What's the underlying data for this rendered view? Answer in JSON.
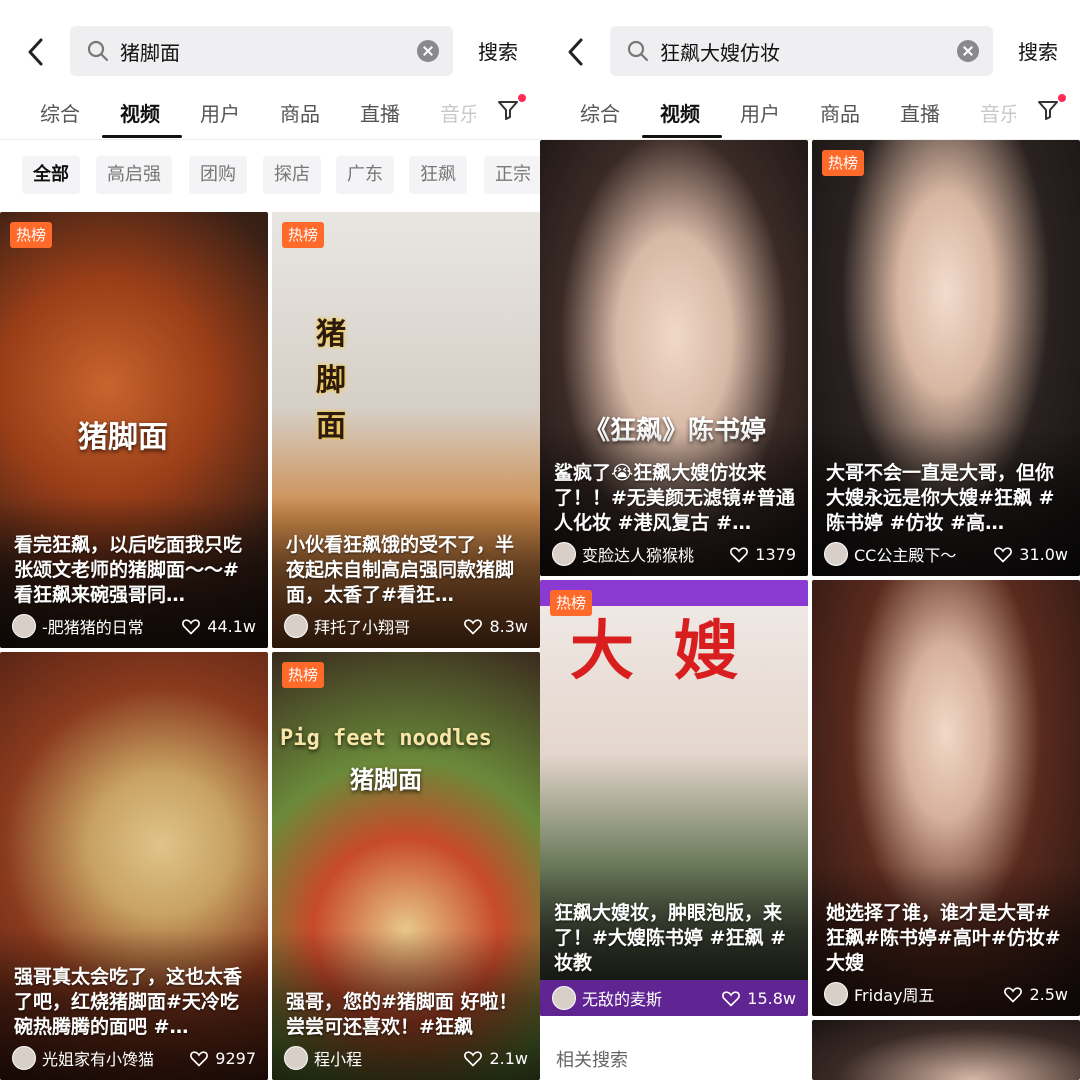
{
  "left": {
    "query": "猪脚面",
    "search_label": "搜索",
    "tabs": [
      "综合",
      "视频",
      "用户",
      "商品",
      "直播",
      "音乐"
    ],
    "active_tab": "视频",
    "chips": [
      "全部",
      "高启强",
      "团购",
      "探店",
      "广东",
      "狂飙",
      "正宗"
    ],
    "cards": [
      {
        "badge": "热榜",
        "overlay": "猪脚面",
        "caption": "看完狂飙，以后吃面我只吃张颂文老师的猪脚面～～#看狂飙来碗强哥同…",
        "author": "-肥猪猪的日常",
        "likes": "44.1w"
      },
      {
        "badge": "热榜",
        "overlay": "猪脚面",
        "caption": "小伙看狂飙饿的受不了，半夜起床自制高启强同款猪脚面，太香了#看狂…",
        "author": "拜托了小翔哥",
        "likes": "8.3w"
      },
      {
        "badge": "",
        "overlay": "",
        "caption": "强哥真太会吃了，这也太香了吧，红烧猪脚面#天冷吃碗热腾腾的面吧 #…",
        "author": "光姐家有小馋猫",
        "likes": "9297"
      },
      {
        "badge": "热榜",
        "overlay": "Pig feet noodles",
        "overlay2": "猪脚面",
        "caption": "强哥，您的#猪脚面 好啦！尝尝可还喜欢！#狂飙",
        "author": "程小程",
        "likes": "2.1w"
      }
    ]
  },
  "right": {
    "query": "狂飙大嫂仿妆",
    "search_label": "搜索",
    "tabs": [
      "综合",
      "视频",
      "用户",
      "商品",
      "直播",
      "音乐"
    ],
    "active_tab": "视频",
    "cards": [
      {
        "badge": "",
        "overlay": "《狂飙》陈书婷",
        "caption": "鲨疯了😭狂飙大嫂仿妆来了！！#无美颜无滤镜#普通人化妆 #港风复古 #…",
        "author": "变脸达人猕猴桃",
        "likes": "1379"
      },
      {
        "badge": "热榜",
        "overlay": "",
        "caption": "大哥不会一直是大哥，但你大嫂永远是你大嫂#狂飙 #陈书婷 #仿妆 #高…",
        "author": "CC公主殿下～",
        "likes": "31.0w"
      },
      {
        "badge": "热榜",
        "overlay": "大嫂",
        "caption": "狂飙大嫂妆，肿眼泡版，来了！#大嫂陈书婷 #狂飙 #妆教",
        "author": "无敌的麦斯",
        "likes": "15.8w"
      },
      {
        "badge": "",
        "overlay": "",
        "caption": "她选择了谁，谁才是大哥#狂飙#陈书婷#高叶#仿妆#大嫂",
        "author": "Friday周五",
        "likes": "2.5w"
      }
    ],
    "related_label": "相关搜索"
  },
  "colors": {
    "hot_badge": "#ff6a2b",
    "accent_dot": "#fe2c55",
    "search_bg": "#efeff1"
  },
  "icons": [
    "back-arrow-icon",
    "search-icon",
    "clear-icon",
    "filter-icon",
    "heart-icon"
  ]
}
